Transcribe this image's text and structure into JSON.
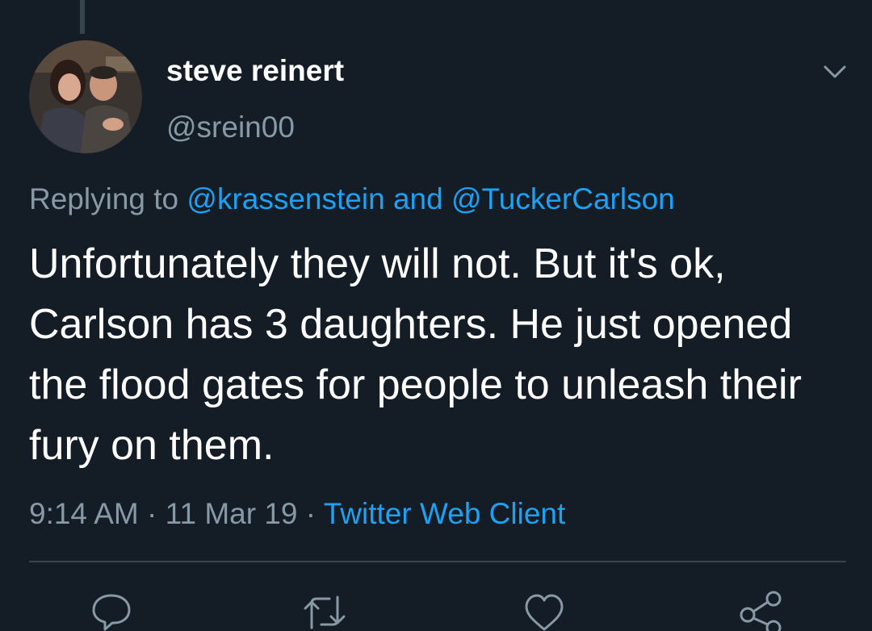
{
  "tweet": {
    "author": {
      "name": "steve reinert",
      "handle": "@srein00"
    },
    "reply_context": {
      "prefix": "Replying to",
      "mention_1": "@krassenstein",
      "conjunction": "and",
      "mention_2": "@TuckerCarlson"
    },
    "text": "Unfortunately they will not. But it's ok, Carlson has 3 daughters. He just opened the flood gates for people to unleash their fury on them.",
    "meta": {
      "time": "9:14 AM",
      "separator_1": "·",
      "date": "11 Mar 19",
      "separator_2": "·",
      "source": "Twitter Web Client"
    }
  },
  "icons": {
    "menu": "chevron-down-icon",
    "reply": "reply-icon",
    "retweet": "retweet-icon",
    "like": "heart-icon",
    "share": "share-icon"
  },
  "colors": {
    "background": "#141d26",
    "secondary_text": "#8899a6",
    "link": "#1da1f2",
    "divider": "#38444d"
  }
}
